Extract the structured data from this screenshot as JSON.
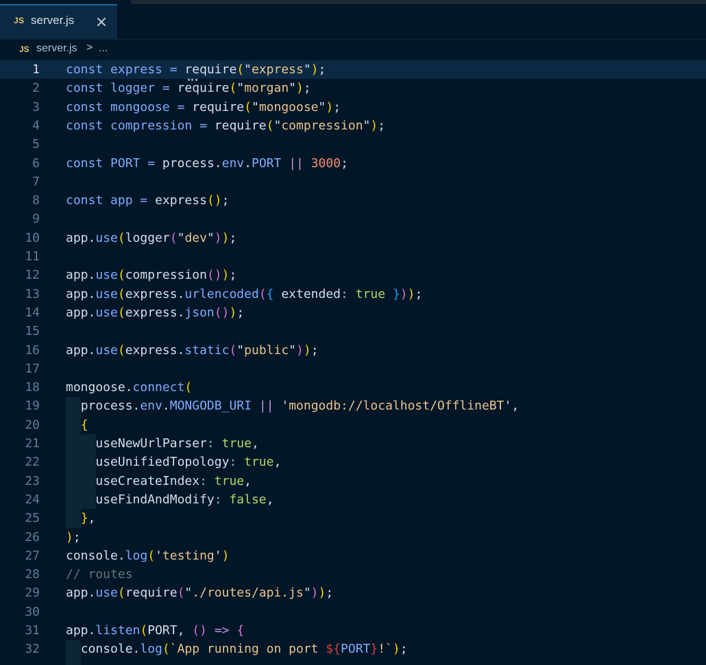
{
  "window": {
    "tab": {
      "icon": "JS",
      "label": "server.js"
    },
    "breadcrumb": {
      "icon": "JS",
      "file": "server.js",
      "separator": ">",
      "more": "..."
    }
  },
  "editor": {
    "language": "javascript",
    "current_line": 1,
    "lines": [
      {
        "n": "1",
        "text": "const express = require(\"express\");"
      },
      {
        "n": "2",
        "text": "const logger = require(\"morgan\");"
      },
      {
        "n": "3",
        "text": "const mongoose = require(\"mongoose\");"
      },
      {
        "n": "4",
        "text": "const compression = require(\"compression\");"
      },
      {
        "n": "5",
        "text": ""
      },
      {
        "n": "6",
        "text": "const PORT = process.env.PORT || 3000;"
      },
      {
        "n": "7",
        "text": ""
      },
      {
        "n": "8",
        "text": "const app = express();"
      },
      {
        "n": "9",
        "text": ""
      },
      {
        "n": "10",
        "text": "app.use(logger(\"dev\"));"
      },
      {
        "n": "11",
        "text": ""
      },
      {
        "n": "12",
        "text": "app.use(compression());"
      },
      {
        "n": "13",
        "text": "app.use(express.urlencoded({ extended: true }));"
      },
      {
        "n": "14",
        "text": "app.use(express.json());"
      },
      {
        "n": "15",
        "text": ""
      },
      {
        "n": "16",
        "text": "app.use(express.static(\"public\"));"
      },
      {
        "n": "17",
        "text": ""
      },
      {
        "n": "18",
        "text": "mongoose.connect("
      },
      {
        "n": "19",
        "text": "  process.env.MONGODB_URI || 'mongodb://localhost/OfflineBT',"
      },
      {
        "n": "20",
        "text": "  {"
      },
      {
        "n": "21",
        "text": "    useNewUrlParser: true,"
      },
      {
        "n": "22",
        "text": "    useUnifiedTopology: true,"
      },
      {
        "n": "23",
        "text": "    useCreateIndex: true,"
      },
      {
        "n": "24",
        "text": "    useFindAndModify: false,"
      },
      {
        "n": "25",
        "text": "  },"
      },
      {
        "n": "26",
        "text": ");"
      },
      {
        "n": "27",
        "text": "console.log('testing')"
      },
      {
        "n": "28",
        "text": "// routes"
      },
      {
        "n": "29",
        "text": "app.use(require(\"./routes/api.js\"));"
      },
      {
        "n": "30",
        "text": ""
      },
      {
        "n": "31",
        "text": "app.listen(PORT, () => {"
      },
      {
        "n": "32",
        "text": "  console.log(`App running on port ${PORT}!`);"
      }
    ]
  },
  "colors": {
    "background": "#011627",
    "current_line": "#0b2942",
    "keyword": "#82aaff",
    "string": "#ecc48d",
    "number": "#f78c6c",
    "boolean": "#addb67",
    "comment": "#637777",
    "property": "#80cbc4"
  }
}
